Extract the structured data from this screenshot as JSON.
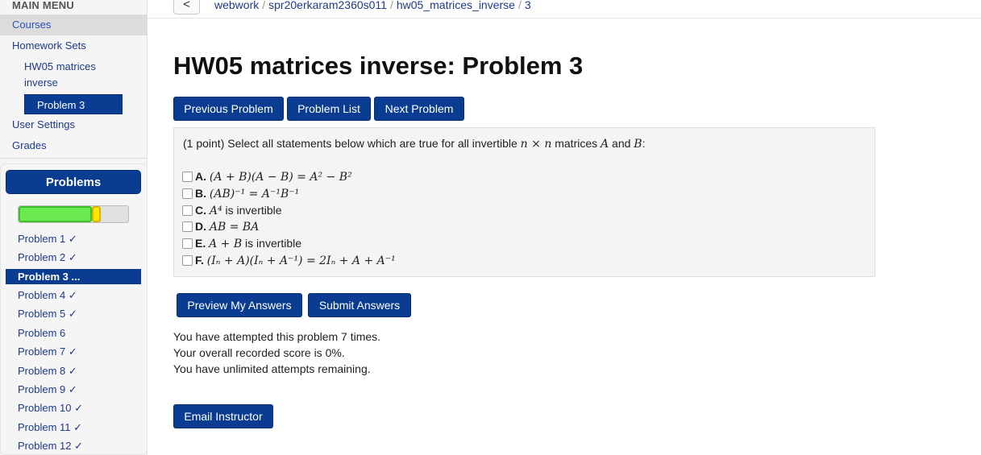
{
  "sidebar": {
    "header": "MAIN MENU",
    "courses": "Courses",
    "homework_sets": "Homework Sets",
    "set_name": "HW05 matrices inverse",
    "current_problem": "Problem 3",
    "user_settings": "User Settings",
    "grades": "Grades"
  },
  "problems": {
    "title": "Problems",
    "progress_green_fraction": 0.67,
    "progress_yellow_fraction": 0.08,
    "items": [
      {
        "label": "Problem 1 ✓"
      },
      {
        "label": "Problem 2 ✓"
      },
      {
        "label": "Problem 3 ..."
      },
      {
        "label": "Problem 4 ✓"
      },
      {
        "label": "Problem 5 ✓"
      },
      {
        "label": "Problem 6"
      },
      {
        "label": "Problem 7 ✓"
      },
      {
        "label": "Problem 8 ✓"
      },
      {
        "label": "Problem 9 ✓"
      },
      {
        "label": "Problem 10 ✓"
      },
      {
        "label": "Problem 11 ✓"
      },
      {
        "label": "Problem 12 ✓"
      }
    ]
  },
  "breadcrumb": {
    "back": "<",
    "parts": [
      "webwork",
      "spr20erkaram2360s011",
      "hw05_matrices_inverse",
      "3"
    ]
  },
  "page": {
    "title": "HW05 matrices inverse: Problem 3"
  },
  "nav": {
    "previous": "Previous Problem",
    "list": "Problem List",
    "next": "Next Problem"
  },
  "problem": {
    "points": "(1 point)",
    "statement_pre": " Select all statements below which are true for all invertible ",
    "statement_n1": "n",
    "statement_times": " × ",
    "statement_n2": "n",
    "statement_mid": " matrices ",
    "statement_A": "A",
    "statement_and": " and ",
    "statement_B": "B",
    "statement_colon": ":",
    "options": [
      {
        "label": "A.",
        "text": "(A + B)(A − B) = A² − B²"
      },
      {
        "label": "B.",
        "text": "(AB)⁻¹ = A⁻¹B⁻¹"
      },
      {
        "label": "C.",
        "math": "A⁴",
        "text": " is invertible"
      },
      {
        "label": "D.",
        "text": "AB = BA"
      },
      {
        "label": "E.",
        "math": "A + B",
        "text": " is invertible"
      },
      {
        "label": "F.",
        "text": "(Iₙ + A)(Iₙ + A⁻¹) = 2Iₙ + A + A⁻¹"
      }
    ]
  },
  "actions": {
    "preview": "Preview My Answers",
    "submit": "Submit Answers"
  },
  "messages": {
    "attempts": "You have attempted this problem 7 times.",
    "score": "Your overall recorded score is 0%.",
    "remaining": "You have unlimited attempts remaining."
  },
  "email": "Email Instructor"
}
